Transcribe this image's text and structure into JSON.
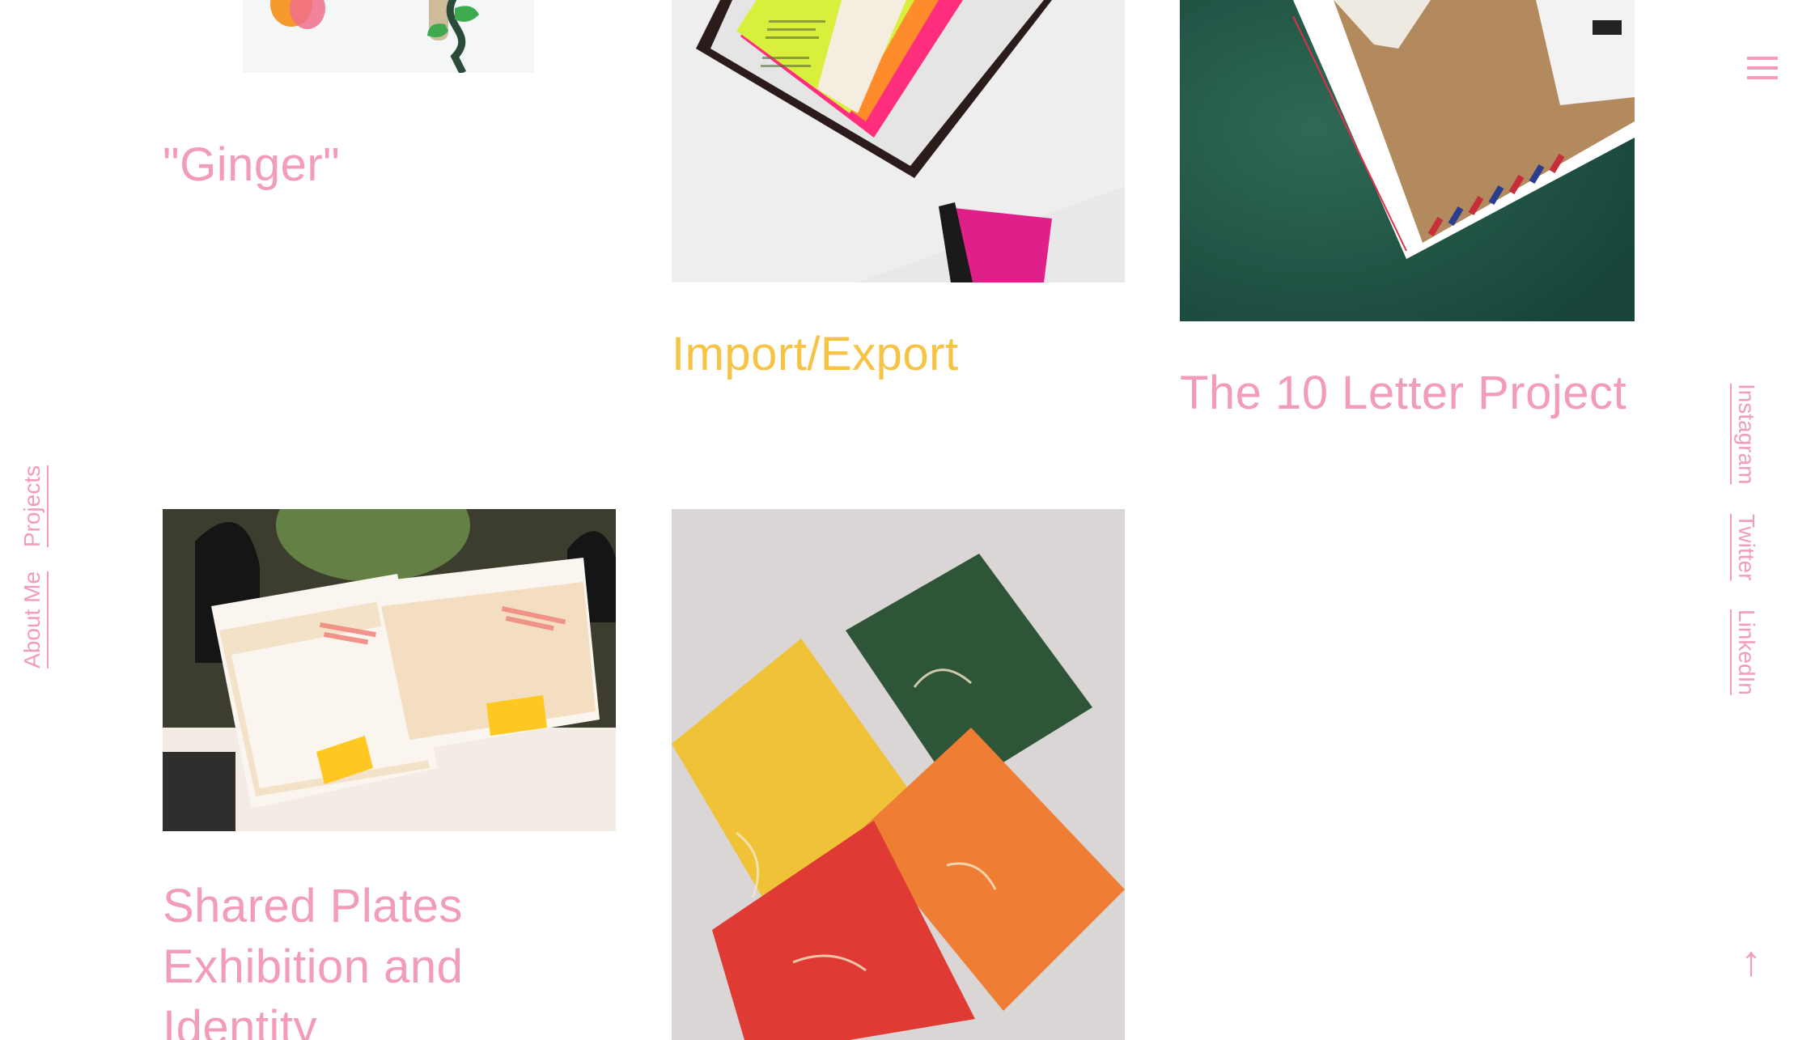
{
  "nav": {
    "projects_label": "Projects",
    "about_label": "About Me"
  },
  "social": {
    "instagram_label": "Instagram",
    "twitter_label": "Twitter",
    "linkedin_label": "LinkedIn"
  },
  "menu_icon": "hamburger-icon",
  "back_to_top": {
    "glyph": "↑",
    "icon": "arrow-up-icon"
  },
  "projects": [
    {
      "title": "\"Ginger\"",
      "color": "#f29bbb"
    },
    {
      "title": "Import/Export",
      "color": "#f7c343"
    },
    {
      "title": "The 10 Letter Project",
      "color": "#f29bbb"
    },
    {
      "title": "Shared Plates Exhibition and Identity",
      "color": "#f29bbb"
    },
    {
      "title": "",
      "color": "#f29bbb"
    }
  ],
  "colors": {
    "accent_pink": "#f29bbb",
    "accent_yellow": "#f7c343",
    "background": "#ffffff"
  }
}
